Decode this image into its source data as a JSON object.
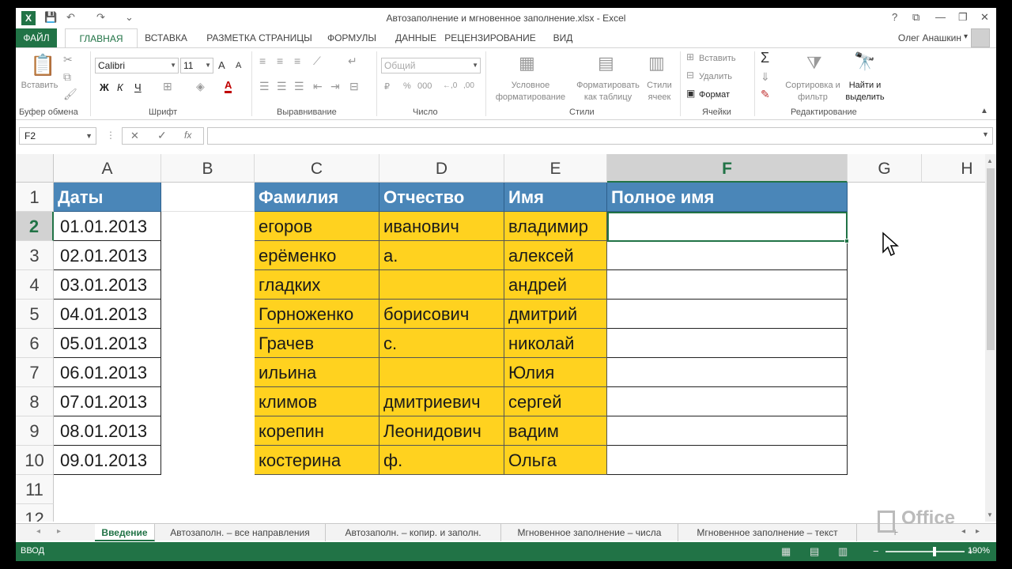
{
  "window": {
    "title": "Автозаполнение и мгновенное заполнение.xlsx - Excel",
    "help": "?",
    "restore_ribbon": "⧉",
    "minimize": "—",
    "maximize": "❐",
    "close": "✕"
  },
  "qat": {
    "save": "💾",
    "undo": "↶",
    "redo": "↷",
    "customize": "⌄"
  },
  "tabs": [
    "ФАЙЛ",
    "ГЛАВНАЯ",
    "ВСТАВКА",
    "РАЗМЕТКА СТРАНИЦЫ",
    "ФОРМУЛЫ",
    "ДАННЫЕ",
    "РЕЦЕНЗИРОВАНИЕ",
    "ВИД"
  ],
  "user": {
    "name": "Олег Анашкин",
    "dd": "▾"
  },
  "ribbon": {
    "clipboard": {
      "label": "Буфер обмена",
      "paste": "Вставить"
    },
    "font": {
      "label": "Шрифт",
      "name": "Calibri",
      "size": "11",
      "bold": "Ж",
      "italic": "К",
      "underline": "Ч",
      "grow": "A",
      "shrink": "A",
      "color": "A"
    },
    "alignment": {
      "label": "Выравнивание"
    },
    "number": {
      "label": "Число",
      "format": "Общий",
      "currency": "₽",
      "percent": "%",
      "thousands": "000",
      "inc_dec": "←,0",
      "dec_dec": ",00"
    },
    "styles": {
      "label": "Стили",
      "conditional": "Условное форматирование",
      "as_table": "Форматировать как таблицу",
      "cell_styles": "Стили ячеек"
    },
    "cells": {
      "label": "Ячейки",
      "insert": "Вставить",
      "delete": "Удалить",
      "format": "Формат"
    },
    "editing": {
      "label": "Редактирование",
      "sum": "Σ",
      "sort": "Сортировка и фильтр",
      "find": "Найти и выделить"
    }
  },
  "formula_bar": {
    "name_box": "F2",
    "cancel": "✕",
    "enter": "✓",
    "fx": "fx",
    "value": ""
  },
  "columns": [
    "A",
    "B",
    "C",
    "D",
    "E",
    "F",
    "G",
    "H"
  ],
  "rows": [
    "1",
    "2",
    "3",
    "4",
    "5",
    "6",
    "7",
    "8",
    "9",
    "10",
    "11",
    "12"
  ],
  "table": {
    "dates_header": "Даты",
    "dates": [
      "01.01.2013",
      "02.01.2013",
      "03.01.2013",
      "04.01.2013",
      "05.01.2013",
      "06.01.2013",
      "07.01.2013",
      "08.01.2013",
      "09.01.2013"
    ],
    "headers": {
      "surname": "Фамилия",
      "patronymic": "Отчество",
      "name": "Имя",
      "full_name": "Полное имя"
    },
    "people": [
      {
        "surname": "егоров",
        "patronymic": "иванович",
        "name": "владимир"
      },
      {
        "surname": "ерёменко",
        "patronymic": "а.",
        "name": "алексей"
      },
      {
        "surname": "гладких",
        "patronymic": "",
        "name": "андрей"
      },
      {
        "surname": "Горноженко",
        "patronymic": "борисович",
        "name": "дмитрий"
      },
      {
        "surname": "Грачев",
        "patronymic": "с.",
        "name": "николай"
      },
      {
        "surname": "ильина",
        "patronymic": "",
        "name": "Юлия"
      },
      {
        "surname": "климов",
        "patronymic": "дмитриевич",
        "name": "сергей"
      },
      {
        "surname": "корепин",
        "patronymic": "Леонидович",
        "name": "вадим"
      },
      {
        "surname": "костерина",
        "patronymic": "ф.",
        "name": "Ольга"
      }
    ]
  },
  "sheets": [
    "Введение",
    "Автозаполн. – все направления",
    "Автозаполн. – копир. и заполн.",
    "Мгновенное заполнение – числа",
    "Мгновенное заполнение – текст"
  ],
  "sheet_nav": {
    "prev": "◂",
    "next": "▸",
    "add": "+"
  },
  "watermark": "Office",
  "status": {
    "mode": "ВВОД",
    "zoom": "190%",
    "zoom_minus": "−",
    "zoom_plus": "+"
  }
}
